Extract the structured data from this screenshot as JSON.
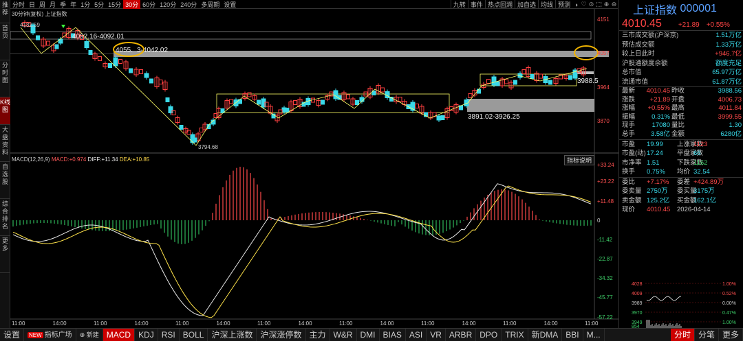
{
  "left_tabs": [
    {
      "label": "推荐",
      "active": false
    },
    {
      "label": "首页",
      "active": false
    },
    {
      "label": "分时图",
      "active": false
    },
    {
      "label": "K线图",
      "active": true
    },
    {
      "label": "大盘资料",
      "active": false
    },
    {
      "label": "自选股",
      "active": false
    },
    {
      "label": "综合排名",
      "active": false
    },
    {
      "label": "更多",
      "active": false
    }
  ],
  "toolbar": {
    "periods": [
      "分时",
      "日",
      "周",
      "月",
      "季",
      "年",
      "1分",
      "5分",
      "15分",
      "30分",
      "60分",
      "120分",
      "240分",
      "多周期",
      "设置"
    ],
    "active_period": "30分",
    "right_items": [
      "九转",
      "事件",
      "热点回溯",
      "加自选",
      "均线",
      "预测"
    ],
    "icons": [
      "◑",
      "♡",
      "⊙",
      "⬚",
      "⊕",
      "⊖"
    ]
  },
  "chart_title": "30分钟(复权)    上证指数",
  "price_axis": [
    "4151",
    "4057",
    "3964",
    "3870"
  ],
  "price_labels": {
    "high_marker": "4132.59",
    "zone1": "4092.16-4092.01",
    "zone2_a": "4055.",
    "zone2_b": "3-4042.02",
    "low_marker": "3794.68",
    "zone3": "3891.02-3926.25",
    "right_tag": "3988.5"
  },
  "macd": {
    "label": "MACD(12,26,9)",
    "macd_label": "MACD:",
    "macd_value": "+0.974",
    "diff_label": "DIFF:",
    "diff_value": "+11.34",
    "dea_label": "DEA:",
    "dea_value": "+10.85",
    "axis": [
      "+33.24",
      "+23.22",
      "+11.48",
      "0",
      "-11.42",
      "-22.87",
      "-34.32",
      "-45.77",
      "-57.22"
    ]
  },
  "indicator_help": "指标说明",
  "time_axis": [
    "11:00",
    "14:00",
    "11:00",
    "14:00",
    "11:00",
    "14:00",
    "11:00",
    "14:00",
    "11:00",
    "14:00",
    "11:00",
    "14:00",
    "11:00",
    "14:00",
    "11:00"
  ],
  "bottom_bar": {
    "items": [
      "设置",
      "指标广场",
      "新建",
      "MACD",
      "KDJ",
      "RSI",
      "BOLL",
      "沪深上涨数",
      "沪深涨停数",
      "主力",
      "W&R",
      "DMI",
      "BIAS",
      "ASI",
      "VR",
      "ARBR",
      "DPO",
      "TRIX",
      "新DMA",
      "BBI",
      "M..."
    ],
    "active": "MACD",
    "new_badge": "NEW",
    "right_tabs": [
      "分时",
      "分笔",
      "更多"
    ]
  },
  "quote": {
    "name": "上证指数",
    "code": "000001",
    "price": "4010.45",
    "change": "+21.89",
    "change_pct": "+0.55%",
    "top_rows": [
      {
        "k": "三市成交额(沪深京)",
        "v": "1.51万亿",
        "cls": "cyan"
      },
      {
        "k": "预估成交额",
        "v": "1.33万亿",
        "cls": "cyan"
      },
      {
        "k": "较上日此时",
        "v": "+946.7亿",
        "cls": "red"
      },
      {
        "k": "沪股通额度余额",
        "v": "额度充足",
        "cls": "cyan"
      },
      {
        "k": "总市值",
        "v": "65.97万亿",
        "cls": "cyan"
      },
      {
        "k": "流通市值",
        "v": "61.87万亿",
        "cls": "cyan"
      }
    ],
    "grid1": [
      [
        "最新",
        "4010.45",
        "昨收",
        "3988.56"
      ],
      [
        "涨跌",
        "+21.89",
        "开盘",
        "4006.73"
      ],
      [
        "涨幅",
        "+0.55%",
        "最高",
        "4011.84"
      ],
      [
        "振幅",
        "0.31%",
        "最低",
        "3999.55"
      ],
      [
        "现手",
        "17080",
        "量比",
        "1.30"
      ],
      [
        "总手",
        "3.58亿",
        "金额",
        "6280亿"
      ]
    ],
    "grid2": [
      [
        "市盈",
        "19.99",
        "上涨家数",
        "1123"
      ],
      [
        "市盈(动)",
        "17.24",
        "平盘家数",
        "66"
      ],
      [
        "市净率",
        "1.51",
        "下跌家数",
        "1162"
      ],
      [
        "换手",
        "0.75%",
        "均价",
        "32.54"
      ]
    ],
    "grid3": [
      [
        "委比",
        "+7.17%",
        "委差",
        "+424.89万"
      ],
      [
        "委卖量",
        "2750万",
        "委买量",
        "3175万"
      ],
      [
        "卖金额",
        "125.2亿",
        "买金额",
        "162.1亿"
      ],
      [
        "现价",
        "4010.45",
        "2026-04-14",
        ""
      ]
    ],
    "mini_axis_left": [
      "4028",
      "4009",
      "3989",
      "3970",
      "3949",
      "854"
    ],
    "mini_axis_right": [
      "1.00%",
      "0.52%",
      "0.00%",
      "0.47%",
      "1.00%"
    ]
  }
}
